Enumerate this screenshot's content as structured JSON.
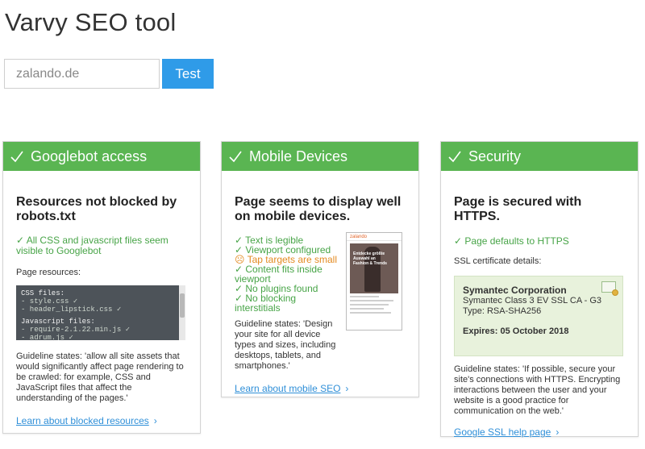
{
  "app": {
    "title": "Varvy SEO tool"
  },
  "search": {
    "value": "zalando.de",
    "button_label": "Test"
  },
  "cards": {
    "googlebot": {
      "header": "Googlebot access",
      "heading": "Resources not blocked by robots.txt",
      "status": "✓ All CSS and javascript files seem visible to Googlebot",
      "resources_label": "Page resources:",
      "code": {
        "css_header": "CSS files:",
        "css_1": "- style.css ✓",
        "css_2": "- header_lipstick.css ✓",
        "js_header": "Javascript files:",
        "js_1": "- require-2.1.22.min.js ✓",
        "js_2": "- adrum.js ✓"
      },
      "guideline": "Guideline states: 'allow all site assets that would significantly affect page rendering to be crawled: for example, CSS and JavaScript files that affect the understanding of the pages.'",
      "link": "Learn about blocked resources",
      "link_chevron": "›"
    },
    "mobile": {
      "header": "Mobile Devices",
      "heading": "Page seems to display well on mobile devices.",
      "checks": [
        "✓ Text is legible",
        "✓ Viewport configured",
        "☹ Tap targets are small",
        "✓ Content fits inside viewport",
        "✓ No plugins found",
        "✓ No blocking interstitials"
      ],
      "thumbnail": {
        "brand": "zalando",
        "hero_text": "Entdecke größte Auswahl an Fashion & Trends"
      },
      "guideline": "Guideline states: 'Design your site for all device types and sizes, including desktops, tablets, and smartphones.'",
      "link": "Learn about mobile SEO",
      "link_chevron": "›"
    },
    "security": {
      "header": "Security",
      "heading": "Page is secured with HTTPS.",
      "status": "✓ Page defaults to HTTPS",
      "details_label": "SSL certificate details:",
      "certificate": {
        "issuer": "Symantec Corporation",
        "authority": "Symantec Class 3 EV SSL CA - G3",
        "type": "Type: RSA-SHA256",
        "expires": "Expires: 05 October 2018"
      },
      "guideline": "Guideline states: 'If possible, secure your site's connections with HTTPS. Encrypting interactions between the user and your website is a good practice for communication on the web.'",
      "link": "Google SSL help page",
      "link_chevron": "›"
    }
  },
  "colors": {
    "header_green": "#5ab552",
    "pass_green": "#47a447",
    "warn_orange": "#e38b22",
    "button_blue": "#2f9be8",
    "link_blue": "#2f8fd8",
    "cert_bg": "#e8f2dc"
  },
  "icons": {
    "card_header": "checkmark-icon",
    "link_arrow": "chevron-right-icon"
  }
}
